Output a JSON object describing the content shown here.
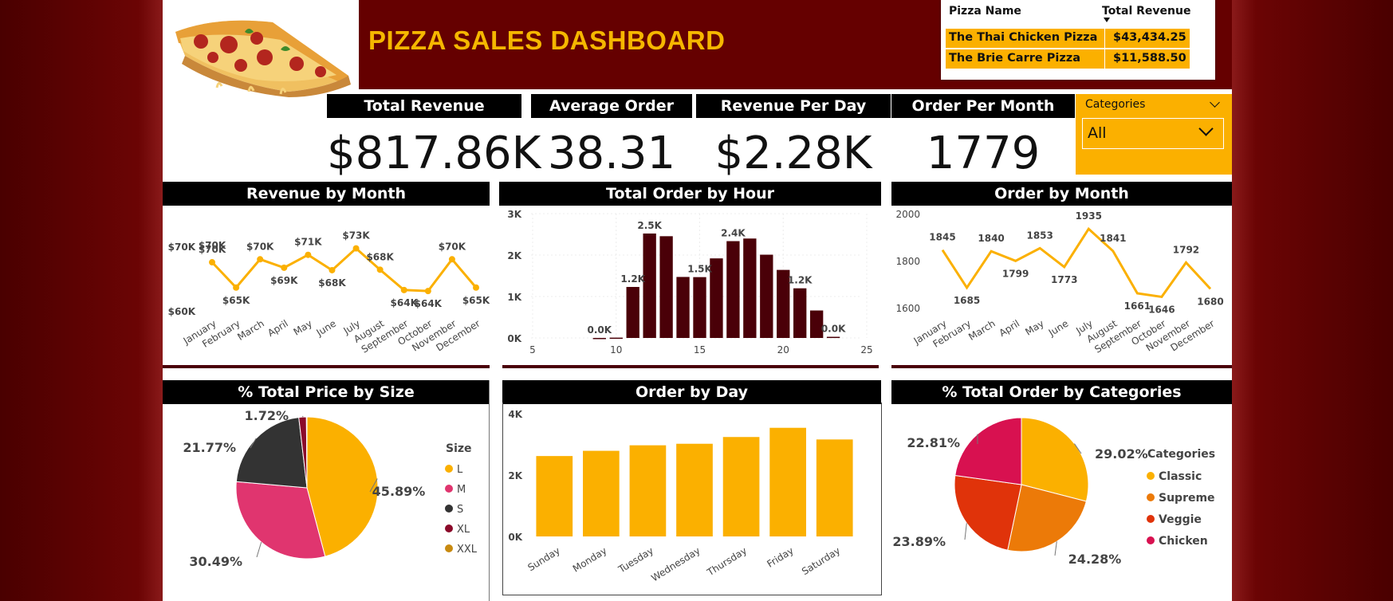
{
  "header": {
    "title": "PIZZA SALES DASHBOARD",
    "pizza_image": "pizza-slice-image"
  },
  "top_table": {
    "columns": [
      "Pizza Name",
      "Total Revenue"
    ],
    "rows": [
      {
        "name": "The Thai Chicken Pizza",
        "revenue": "$43,434.25"
      },
      {
        "name": "The Brie Carre Pizza",
        "revenue": "$11,588.50"
      }
    ],
    "sort_icon": "sort-desc-icon"
  },
  "kpis": [
    {
      "label": "Total Revenue",
      "value": "$817.86K"
    },
    {
      "label": "Average Order",
      "value": "38.31"
    },
    {
      "label": "Revenue Per Day",
      "value": "$2.28K"
    },
    {
      "label": "Order Per Month",
      "value": "1779"
    }
  ],
  "filter": {
    "label": "Categories",
    "value": "All",
    "icon": "chevron-down-icon"
  },
  "colors": {
    "banner": "#650000",
    "accent_yellow": "#fbb000",
    "bar_dark": "#4a0008",
    "line": "#fbb000"
  },
  "chart_data": [
    {
      "id": "revenue_by_month",
      "type": "line",
      "title": "Revenue by Month",
      "categories": [
        "January",
        "February",
        "March",
        "April",
        "May",
        "June",
        "July",
        "August",
        "September",
        "October",
        "November",
        "December"
      ],
      "values": [
        69.8,
        64.7,
        70.4,
        68.7,
        71.3,
        68.2,
        72.6,
        68.3,
        64.2,
        64.0,
        70.4,
        64.7
      ],
      "labels": [
        "$70K",
        "$65K",
        "$70K",
        "$69K",
        "$71K",
        "$68K",
        "$73K",
        "$68K",
        "$64K",
        "$64K",
        "$70K",
        "$65K"
      ],
      "y_ticks": [
        "$70K",
        "$60K"
      ],
      "ylim": [
        60,
        78
      ],
      "extra_label": "$70K"
    },
    {
      "id": "total_order_by_hour",
      "type": "bar",
      "title": "Total Order by Hour",
      "x": [
        9,
        10,
        11,
        12,
        13,
        14,
        15,
        16,
        17,
        18,
        19,
        20,
        21,
        22,
        23
      ],
      "values": [
        0.001,
        0.008,
        1.231,
        2.52,
        2.455,
        1.472,
        1.468,
        1.92,
        2.336,
        2.399,
        2.009,
        1.642,
        1.198,
        0.663,
        0.028
      ],
      "data_labels": [
        {
          "x": 9,
          "text": "0.0K"
        },
        {
          "x": 11,
          "text": "1.2K"
        },
        {
          "x": 12,
          "text": "2.5K"
        },
        {
          "x": 15,
          "text": "1.5K"
        },
        {
          "x": 17,
          "text": "2.4K"
        },
        {
          "x": 21,
          "text": "1.2K"
        },
        {
          "x": 23,
          "text": "0.0K"
        }
      ],
      "x_ticks": [
        5,
        10,
        15,
        20,
        25
      ],
      "y_ticks": [
        "3K",
        "2K",
        "1K",
        "0K"
      ],
      "ylim": [
        0,
        3
      ],
      "xlim": [
        5,
        25
      ]
    },
    {
      "id": "order_by_month",
      "type": "line",
      "title": "Order by Month",
      "categories": [
        "January",
        "February",
        "March",
        "April",
        "May",
        "June",
        "July",
        "August",
        "September",
        "October",
        "November",
        "December"
      ],
      "values": [
        1845,
        1685,
        1840,
        1799,
        1853,
        1773,
        1935,
        1841,
        1661,
        1646,
        1792,
        1680
      ],
      "y_ticks": [
        2000,
        1800,
        1600
      ],
      "ylim": [
        1600,
        2000
      ]
    },
    {
      "id": "pct_price_by_size",
      "type": "pie",
      "title": "% Total Price by Size",
      "legend_title": "Size",
      "slices": [
        {
          "name": "L",
          "value": 45.89,
          "label": "45.89%",
          "color": "#fbb000"
        },
        {
          "name": "M",
          "value": 30.49,
          "label": "30.49%",
          "color": "#e0356f"
        },
        {
          "name": "S",
          "value": 21.77,
          "label": "21.77%",
          "color": "#333333"
        },
        {
          "name": "XL",
          "value": 1.72,
          "label": "1.72%",
          "color": "#8b0a2a"
        },
        {
          "name": "XXL",
          "value": 0.13,
          "label": "",
          "color": "#c88a10"
        }
      ]
    },
    {
      "id": "order_by_day",
      "type": "bar",
      "title": "Order by Day",
      "categories": [
        "Sunday",
        "Monday",
        "Tuesday",
        "Wednesday",
        "Thursday",
        "Friday",
        "Saturday"
      ],
      "values": [
        2.62,
        2.79,
        2.97,
        3.02,
        3.24,
        3.54,
        3.16
      ],
      "y_ticks": [
        "4K",
        "2K",
        "0K"
      ],
      "ylim": [
        0,
        4
      ]
    },
    {
      "id": "pct_order_by_categories",
      "type": "pie",
      "title": "% Total Order by Categories",
      "legend_title": "Categories",
      "slices": [
        {
          "name": "Classic",
          "value": 29.02,
          "label": "29.02%",
          "color": "#fbb000"
        },
        {
          "name": "Supreme",
          "value": 24.28,
          "label": "24.28%",
          "color": "#ec7a08"
        },
        {
          "name": "Veggie",
          "value": 23.89,
          "label": "23.89%",
          "color": "#e0330a"
        },
        {
          "name": "Chicken",
          "value": 22.81,
          "label": "22.81%",
          "color": "#d81150"
        }
      ]
    }
  ]
}
